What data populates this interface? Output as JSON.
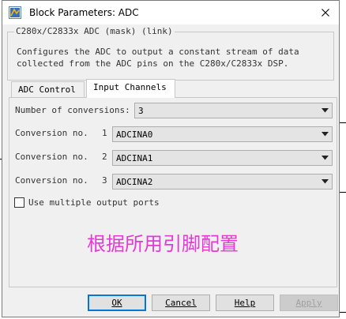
{
  "window": {
    "title": "Block Parameters: ADC"
  },
  "description_group": {
    "legend": "C280x/C2833x ADC (mask) (link)",
    "text": "Configures the ADC to output a constant stream of data\ncollected from the ADC pins on the C280x/C2833x DSP."
  },
  "tabs": [
    {
      "label": "ADC Control",
      "active": false
    },
    {
      "label": "Input Channels",
      "active": true
    }
  ],
  "input_channels": {
    "num_conversions": {
      "label": "Number of conversions:",
      "value": "3"
    },
    "conversions": [
      {
        "label": "Conversion no.",
        "index": "1",
        "value": "ADCINA0"
      },
      {
        "label": "Conversion no.",
        "index": "2",
        "value": "ADCINA1"
      },
      {
        "label": "Conversion no.",
        "index": "3",
        "value": "ADCINA2"
      }
    ],
    "multiple_output_ports": {
      "label": "Use multiple output ports",
      "checked": false
    }
  },
  "annotation": {
    "text": "根据所用引脚配置",
    "color": "#e23ad3"
  },
  "buttons": {
    "ok": {
      "label": "OK"
    },
    "cancel": {
      "label": "Cancel"
    },
    "help": {
      "label": "Help"
    },
    "apply": {
      "label": "Apply",
      "disabled": true
    }
  },
  "icons": {
    "app": "simulink-app-icon",
    "close": "close-icon",
    "dropdown": "chevron-down-icon"
  }
}
